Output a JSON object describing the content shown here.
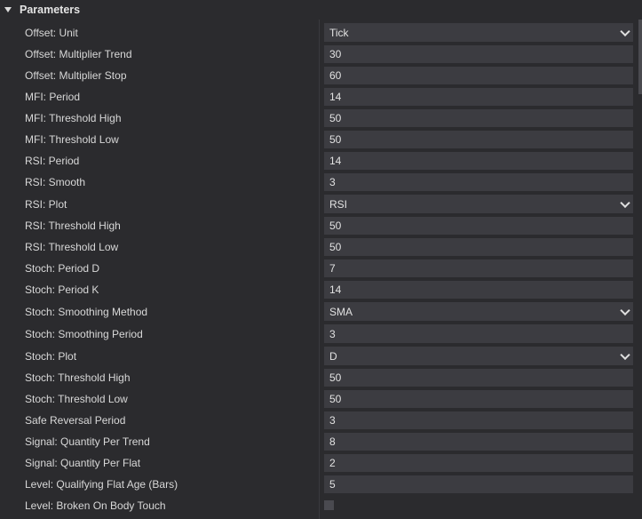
{
  "section": {
    "title": "Parameters"
  },
  "params": [
    {
      "label": "Offset: Unit",
      "value": "Tick",
      "type": "select"
    },
    {
      "label": "Offset: Multiplier Trend",
      "value": "30",
      "type": "number"
    },
    {
      "label": "Offset: Multiplier Stop",
      "value": "60",
      "type": "number"
    },
    {
      "label": "MFI: Period",
      "value": "14",
      "type": "number"
    },
    {
      "label": "MFI: Threshold High",
      "value": "50",
      "type": "number"
    },
    {
      "label": "MFI: Threshold Low",
      "value": "50",
      "type": "number"
    },
    {
      "label": "RSI: Period",
      "value": "14",
      "type": "number"
    },
    {
      "label": "RSI: Smooth",
      "value": "3",
      "type": "number"
    },
    {
      "label": "RSI: Plot",
      "value": "RSI",
      "type": "select"
    },
    {
      "label": "RSI: Threshold High",
      "value": "50",
      "type": "number"
    },
    {
      "label": "RSI: Threshold Low",
      "value": "50",
      "type": "number"
    },
    {
      "label": "Stoch: Period D",
      "value": "7",
      "type": "number"
    },
    {
      "label": "Stoch: Period K",
      "value": "14",
      "type": "number"
    },
    {
      "label": "Stoch: Smoothing Method",
      "value": "SMA",
      "type": "select"
    },
    {
      "label": "Stoch: Smoothing Period",
      "value": "3",
      "type": "number"
    },
    {
      "label": "Stoch: Plot",
      "value": "D",
      "type": "select"
    },
    {
      "label": "Stoch: Threshold High",
      "value": "50",
      "type": "number"
    },
    {
      "label": "Stoch: Threshold Low",
      "value": "50",
      "type": "number"
    },
    {
      "label": "Safe Reversal Period",
      "value": "3",
      "type": "number"
    },
    {
      "label": "Signal: Quantity Per Trend",
      "value": "8",
      "type": "number"
    },
    {
      "label": "Signal: Quantity Per Flat",
      "value": "2",
      "type": "number"
    },
    {
      "label": "Level: Qualifying Flat Age (Bars)",
      "value": "5",
      "type": "number"
    },
    {
      "label": "Level: Broken On Body Touch",
      "value": false,
      "type": "checkbox"
    }
  ],
  "colors": {
    "background": "#2b2b2e",
    "field": "#3c3c41",
    "text": "#dcdcdc"
  }
}
